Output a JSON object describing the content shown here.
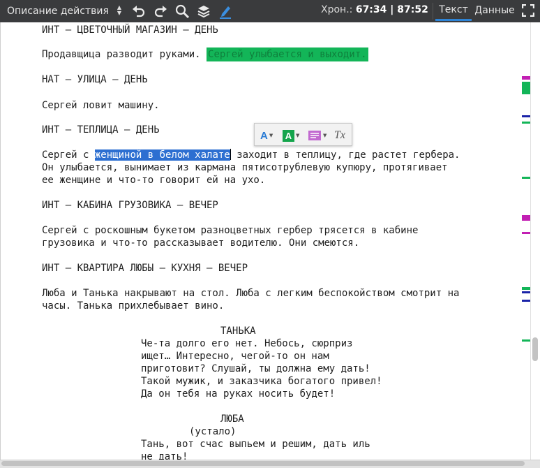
{
  "toolbar": {
    "block_type": "Описание действия",
    "chron_label": "Хрон.:",
    "chron_value": "67:34 | 87:52",
    "tabs": [
      "Текст",
      "Данные"
    ],
    "icons": [
      "undo-icon",
      "redo-icon",
      "search-icon",
      "layers-icon",
      "pen-icon",
      "fullscreen-icon"
    ],
    "accent": "#2e84d6"
  },
  "script": {
    "l1": "ИНТ – ЦВЕТОЧНЫЙ МАГАЗИН – ДЕНЬ",
    "l2a": "Продавщица разводит руками.",
    "l2b": "Сергей улыбается и выходит.",
    "l3": "НАТ – УЛИЦА – ДЕНЬ",
    "l4": "Сергей ловит машину.",
    "l5": "ИНТ – ТЕПЛИЦА – ДЕНЬ",
    "l6a": "Сергей с",
    "l6sel": "женщиной в белом халате",
    "l6b": "заходит в теплицу, где растет гербера.",
    "l7": "Он улыбается, вынимает из кармана пятисотрублевую купюру, протягивает",
    "l8": "ее женщине и что-то говорит ей на ухо.",
    "l9": "ИНТ – КАБИНА ГРУЗОВИКА – ВЕЧЕР",
    "l10": "Сергей с роскошным букетом разноцветных гербер трясется в кабине",
    "l11": "грузовика и что-то рассказывает водителю. Они смеются.",
    "l12": "ИНТ – КВАРТИРА ЛЮБЫ – КУХНЯ – ВЕЧЕР",
    "l13": "Люба и Танька накрывают на стол. Люба с легким беспокойством смотрит на",
    "l14": "часы. Танька прихлебывает вино.",
    "c1": "ТАНЬКА",
    "d1": "Че-та долго его нет. Небось, сюрприз",
    "d2": "ищет… Интересно, чегой-то он нам",
    "d3": "приготовит? Слушай, ты должна ему дать!",
    "d4": "Такой мужик, и заказчика богатого привел!",
    "d5": "Да он тебя на руках носить будет!",
    "c2": "ЛЮБА",
    "p1": "(устало)",
    "d6": "Тань, вот счас выпьем и решим, дать иль",
    "d7": "не дать!"
  },
  "format_toolbar": {
    "icons": [
      "text-color-icon",
      "highlight-color-icon",
      "comment-icon",
      "clear-format-icon"
    ],
    "text_color_glyph": "A",
    "highlight_glyph": "A",
    "clear_glyph": "Tx"
  },
  "markers": {
    "colors": [
      "#c21fb3",
      "#13b558",
      "#1a23a8"
    ]
  }
}
